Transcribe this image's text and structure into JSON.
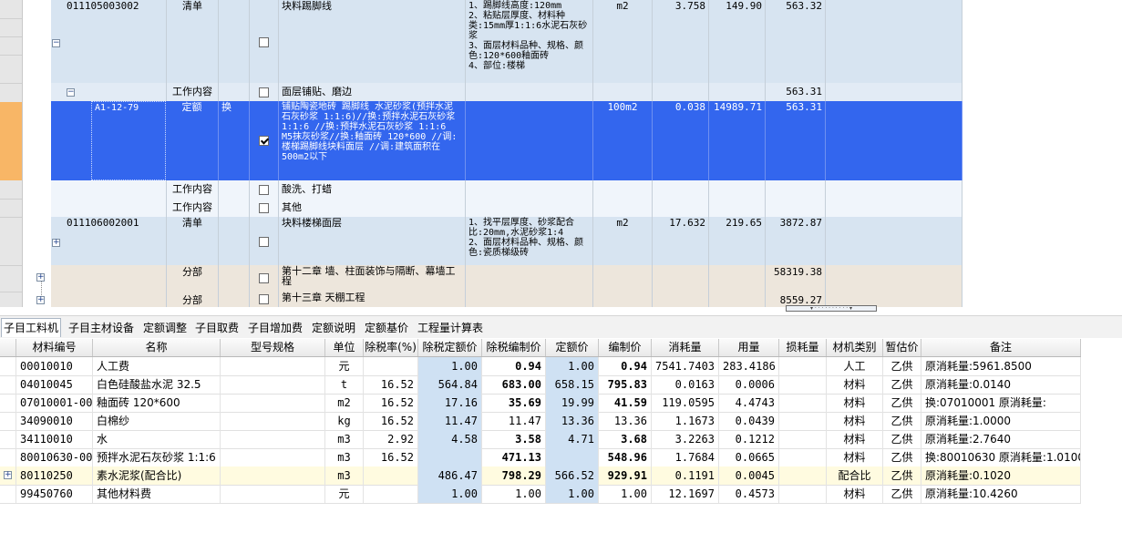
{
  "upper": {
    "rows": [
      {
        "code": "011105003002",
        "type": "清单",
        "flag": "",
        "checked": false,
        "name": "块料踢脚线",
        "feature": "1、踢脚线高度:120mm\n2、粘贴层厚度、材料种类:15mm厚1:1:6水泥石灰砂浆\n3、面层材料品种、规格、颜色:120*600釉面砖\n4、部位:楼梯",
        "unit": "m2",
        "qty": "3.758",
        "price": "149.90",
        "total": "563.32"
      },
      {
        "code": "",
        "type": "工作内容",
        "flag": "",
        "checked": false,
        "name": "面层铺贴、磨边",
        "feature": "",
        "unit": "",
        "qty": "",
        "price": "",
        "total": "563.31"
      },
      {
        "code": "A1-12-79",
        "type": "定额",
        "flag": "换",
        "checked": true,
        "name": "铺贴陶瓷地砖 踢脚线 水泥砂浆(预拌水泥石灰砂浆 1:1:6)//换:预拌水泥石灰砂浆 1:1:6 //换:预拌水泥石灰砂浆 1:1:6 M5抹灰砂浆//换:釉面砖 120*600 //调:楼梯踢脚线块料面层 //调:建筑面积在500m2以下",
        "feature": "",
        "unit": "100m2",
        "qty": "0.038",
        "price": "14989.71",
        "total": "563.31"
      },
      {
        "code": "",
        "type": "工作内容",
        "flag": "",
        "checked": false,
        "name": "酸洗、打蜡",
        "feature": "",
        "unit": "",
        "qty": "",
        "price": "",
        "total": ""
      },
      {
        "code": "",
        "type": "工作内容",
        "flag": "",
        "checked": false,
        "name": "其他",
        "feature": "",
        "unit": "",
        "qty": "",
        "price": "",
        "total": ""
      },
      {
        "code": "011106002001",
        "type": "清单",
        "flag": "",
        "checked": false,
        "name": "块料楼梯面层",
        "feature": "1、找平层厚度、砂浆配合比:20mm,水泥砂浆1:4\n2、面层材料品种、规格、颜色:瓷质梯级砖",
        "unit": "m2",
        "qty": "17.632",
        "price": "219.65",
        "total": "3872.87"
      },
      {
        "code": "",
        "type": "分部",
        "flag": "",
        "checked": false,
        "name": "第十二章 墙、柱面装饰与隔断、幕墙工程",
        "feature": "",
        "unit": "",
        "qty": "",
        "price": "",
        "total": "58319.38"
      },
      {
        "code": "",
        "type": "分部",
        "flag": "",
        "checked": false,
        "name": "第十三章 天棚工程",
        "feature": "",
        "unit": "",
        "qty": "",
        "price": "",
        "total": "8559.27"
      }
    ]
  },
  "tabs": [
    "子目工料机",
    "子目主材设备",
    "定额调整",
    "子目取费",
    "子目增加费",
    "定额说明",
    "定额基价",
    "工程量计算表"
  ],
  "table": {
    "headers": [
      "材料编号",
      "名称",
      "型号规格",
      "单位",
      "除税率(%)",
      "除税定额价",
      "除税编制价",
      "定额价",
      "编制价",
      "消耗量",
      "用量",
      "损耗量",
      "材机类别",
      "暂估价",
      "备注"
    ],
    "rows": [
      {
        "code": "00010010",
        "name": "人工费",
        "spec": "",
        "unit": "元",
        "rate": "",
        "dj": "1.00",
        "bz": "0.94",
        "de": "1.00",
        "bzj": "0.94",
        "xh": "7541.7403",
        "yl": "283.4186",
        "sh": "",
        "lb": "人工",
        "zg": "乙供",
        "bz2": "原消耗量:5961.8500"
      },
      {
        "code": "04010045",
        "name": "白色硅酸盐水泥 32.5",
        "spec": "",
        "unit": "t",
        "rate": "16.52",
        "dj": "564.84",
        "bz": "683.00",
        "de": "658.15",
        "bzj": "795.83",
        "xh": "0.0163",
        "yl": "0.0006",
        "sh": "",
        "lb": "材料",
        "zg": "乙供",
        "bz2": "原消耗量:0.0140"
      },
      {
        "code": "07010001-0001",
        "name": "釉面砖 120*600",
        "spec": "",
        "unit": "m2",
        "rate": "16.52",
        "dj": "17.16",
        "bz": "35.69",
        "de": "19.99",
        "bzj": "41.59",
        "xh": "119.0595",
        "yl": "4.4743",
        "sh": "",
        "lb": "材料",
        "zg": "乙供",
        "bz2": "换:07010001 原消耗量:"
      },
      {
        "code": "34090010",
        "name": "白棉纱",
        "spec": "",
        "unit": "kg",
        "rate": "16.52",
        "dj": "11.47",
        "bz": "11.47",
        "de": "13.36",
        "bzj": "13.36",
        "xh": "1.1673",
        "yl": "0.0439",
        "sh": "",
        "lb": "材料",
        "zg": "乙供",
        "bz2": "原消耗量:1.0000"
      },
      {
        "code": "34110010",
        "name": "水",
        "spec": "",
        "unit": "m3",
        "rate": "2.92",
        "dj": "4.58",
        "bz": "3.58",
        "de": "4.71",
        "bzj": "3.68",
        "xh": "3.2263",
        "yl": "0.1212",
        "sh": "",
        "lb": "材料",
        "zg": "乙供",
        "bz2": "原消耗量:2.7640"
      },
      {
        "code": "80010630-0002",
        "name": "预拌水泥石灰砂浆 1:1:6 M5抹灰砂浆",
        "spec": "",
        "unit": "m3",
        "rate": "16.52",
        "dj": "",
        "bz": "471.13",
        "de": "",
        "bzj": "548.96",
        "xh": "1.7684",
        "yl": "0.0665",
        "sh": "",
        "lb": "材料",
        "zg": "乙供",
        "bz2": "换:80010630 原消耗量:1.0100"
      },
      {
        "code": "80110250",
        "name": "素水泥浆(配合比)",
        "spec": "",
        "unit": "m3",
        "rate": "",
        "dj": "486.47",
        "bz": "798.29",
        "de": "566.52",
        "bzj": "929.91",
        "xh": "0.1191",
        "yl": "0.0045",
        "sh": "",
        "lb": "配合比",
        "zg": "乙供",
        "bz2": "原消耗量:0.1020"
      },
      {
        "code": "99450760",
        "name": "其他材料费",
        "spec": "",
        "unit": "元",
        "rate": "",
        "dj": "1.00",
        "bz": "1.00",
        "de": "1.00",
        "bzj": "1.00",
        "xh": "12.1697",
        "yl": "0.4573",
        "sh": "",
        "lb": "材料",
        "zg": "乙供",
        "bz2": "原消耗量:10.4260"
      }
    ]
  }
}
